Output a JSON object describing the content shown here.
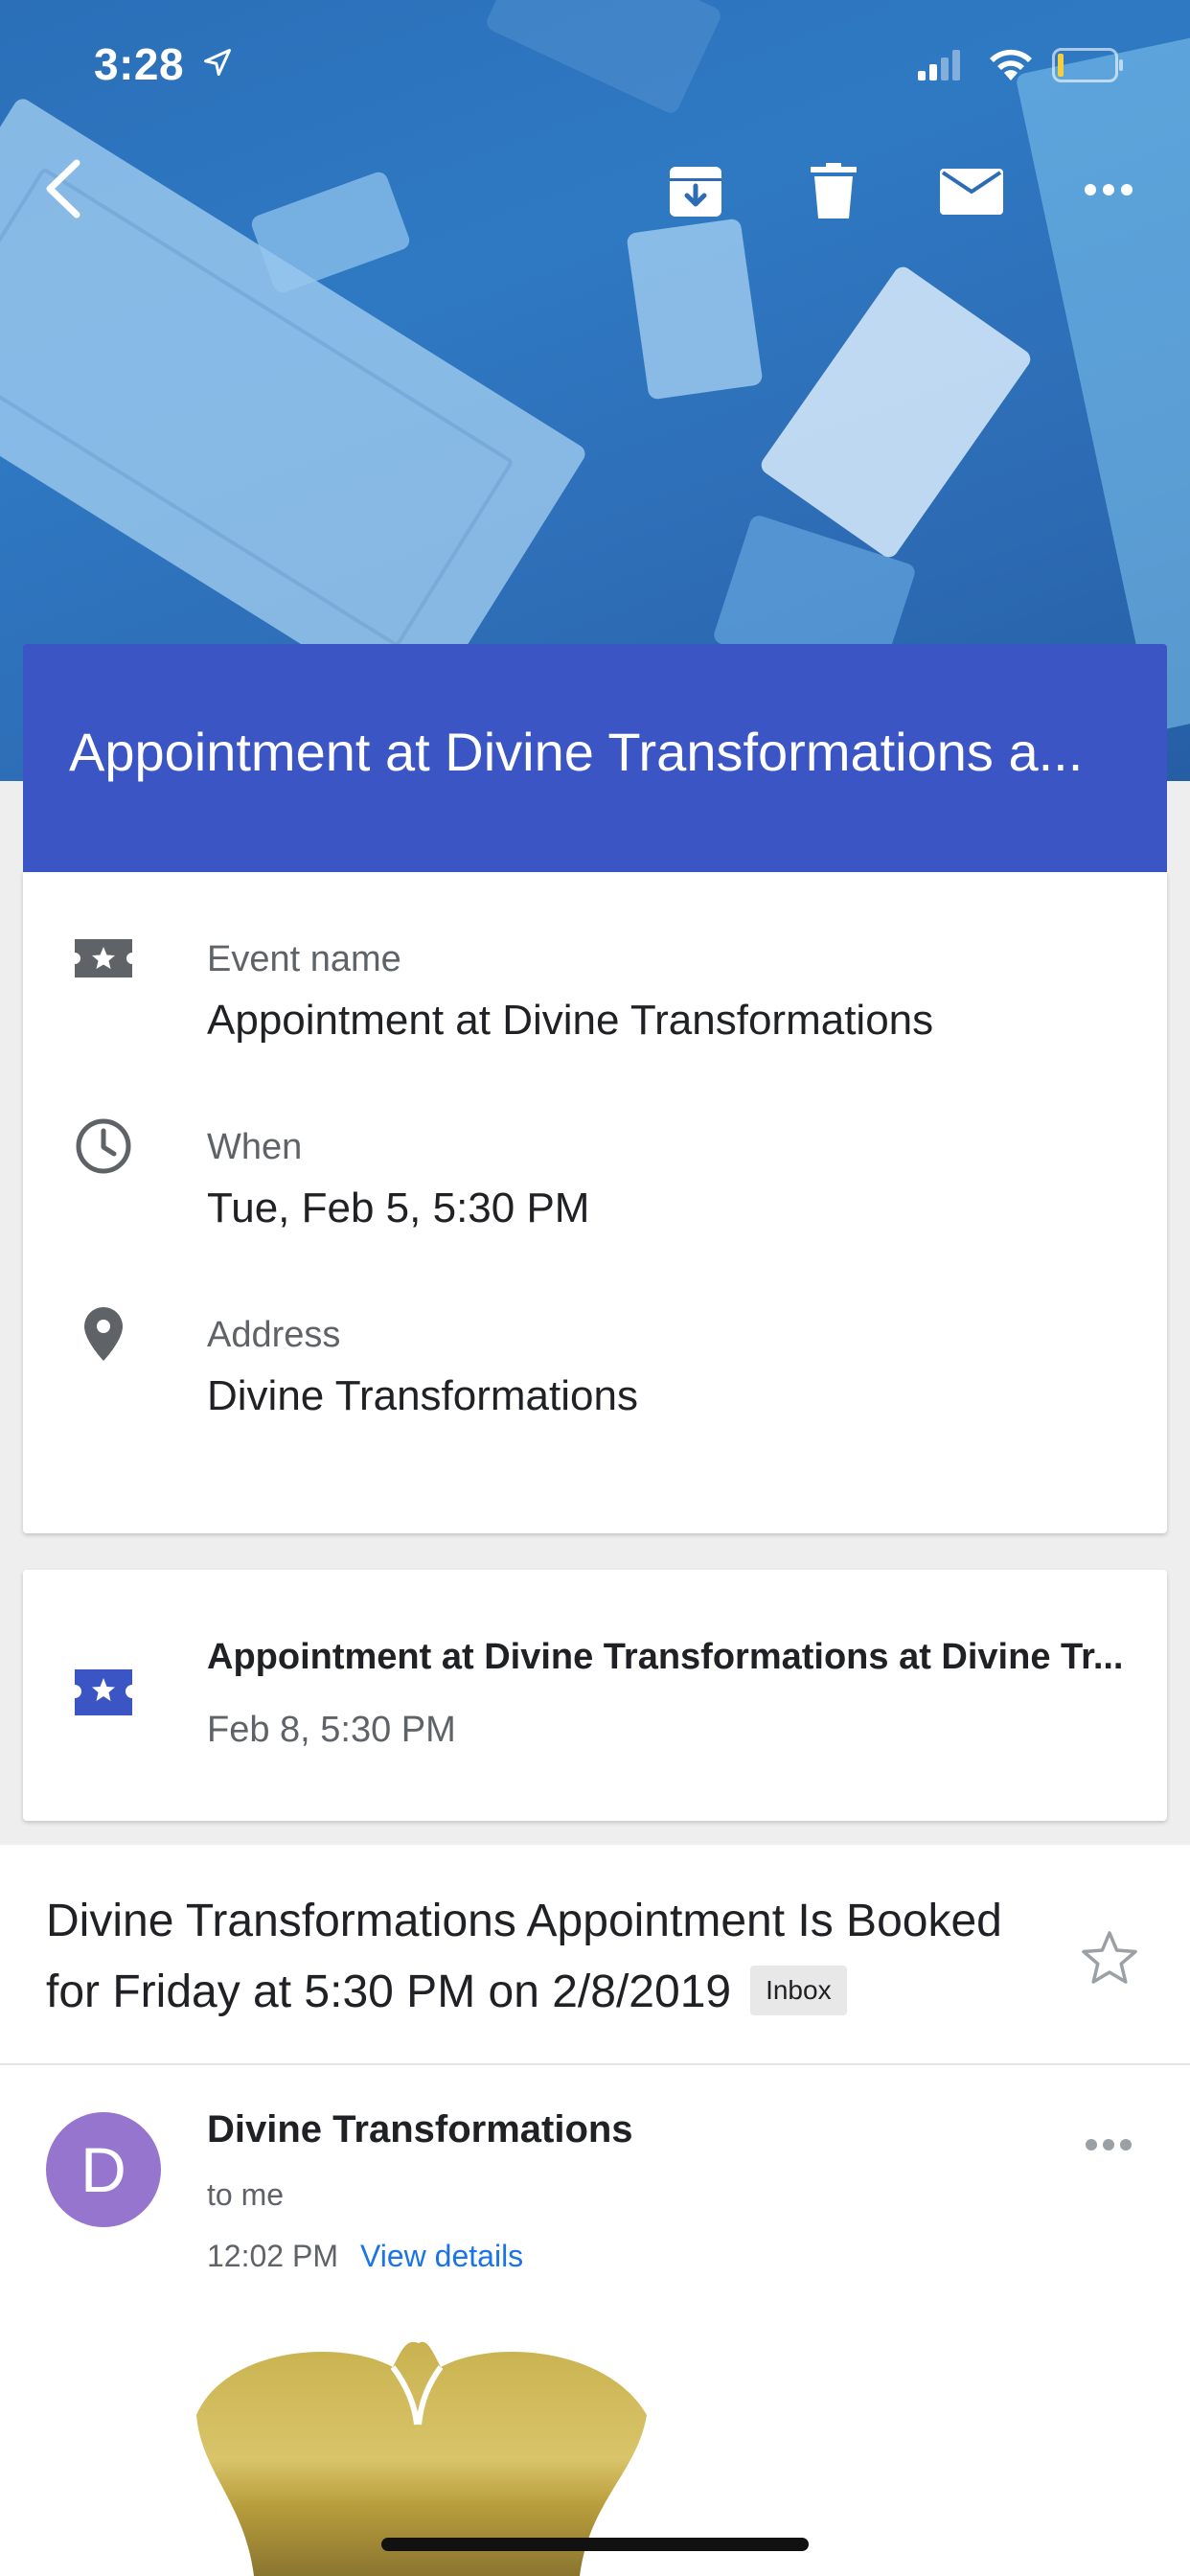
{
  "status_bar": {
    "time": "3:28"
  },
  "toolbar": {
    "icons": [
      "back-icon",
      "archive-icon",
      "delete-icon",
      "mail-icon",
      "more-icon"
    ]
  },
  "event_card": {
    "title": "Appointment at Divine Transformations a...",
    "header_color": "#3b55c4",
    "rows": [
      {
        "icon": "ticket-icon",
        "label": "Event name",
        "value": "Appointment at Divine Transformations"
      },
      {
        "icon": "clock-icon",
        "label": "When",
        "value": "Tue, Feb 5, 5:30 PM"
      },
      {
        "icon": "location-pin-icon",
        "label": "Address",
        "value": "Divine Transformations"
      }
    ]
  },
  "related_event": {
    "icon": "ticket-icon",
    "icon_color": "#3b55c4",
    "title": "Appointment at Divine Transformations at Divine Tr...",
    "date": "Feb 8, 5:30 PM"
  },
  "email": {
    "subject": "Divine Transformations Appointment Is Booked for Friday at 5:30 PM on 2/8/2019",
    "label": "Inbox",
    "starred": false,
    "sender": {
      "initial": "D",
      "avatar_color": "#9575cd",
      "name": "Divine Transformations",
      "recipient": "to me",
      "time": "12:02 PM",
      "details_link": "View details"
    }
  }
}
